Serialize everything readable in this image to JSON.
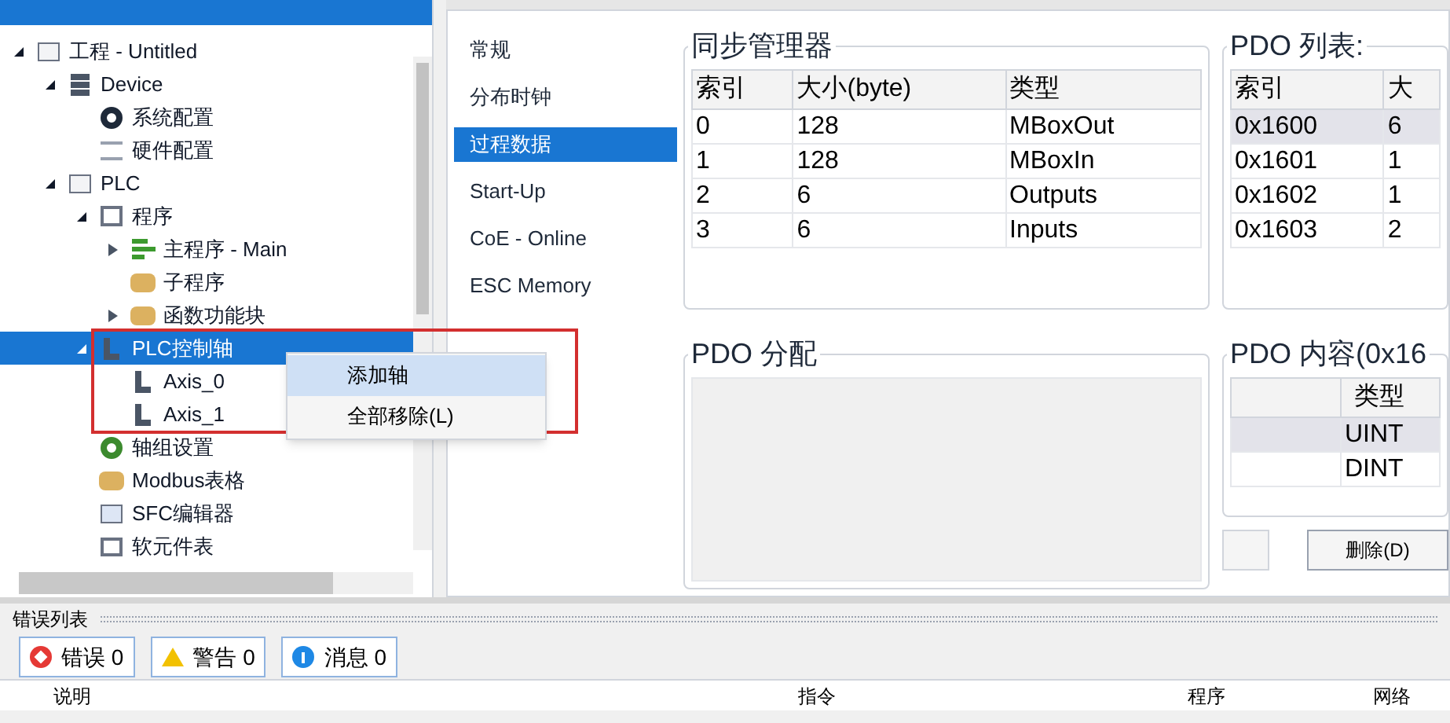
{
  "tree": [
    {
      "label": "工程 - Untitled",
      "kind": "project",
      "expanded": true,
      "selected": false,
      "children": [
        {
          "label": "Device",
          "kind": "device",
          "expanded": true,
          "selected": false,
          "children": [
            {
              "label": "系统配置",
              "kind": "gear",
              "selected": false
            },
            {
              "label": "硬件配置",
              "kind": "hardware",
              "selected": false
            }
          ]
        },
        {
          "label": "PLC",
          "kind": "plc",
          "expanded": true,
          "selected": false,
          "children": [
            {
              "label": "程序",
              "kind": "program",
              "expanded": true,
              "selected": false,
              "children": [
                {
                  "label": "主程序 - Main",
                  "kind": "main",
                  "expanded": false,
                  "selected": false
                },
                {
                  "label": "子程序",
                  "kind": "folder",
                  "selected": false
                },
                {
                  "label": "函数功能块",
                  "kind": "folder",
                  "expanded": false,
                  "selected": false
                }
              ]
            },
            {
              "label": "PLC控制轴",
              "kind": "axis",
              "expanded": true,
              "selected": true,
              "children": [
                {
                  "label": "Axis_0",
                  "kind": "axis",
                  "selected": false
                },
                {
                  "label": "Axis_1",
                  "kind": "axis",
                  "selected": false
                }
              ]
            },
            {
              "label": "轴组设置",
              "kind": "greengear",
              "selected": false
            },
            {
              "label": "Modbus表格",
              "kind": "folder",
              "selected": false
            },
            {
              "label": "SFC编辑器",
              "kind": "sfc",
              "selected": false
            },
            {
              "label": "软元件表",
              "kind": "table",
              "selected": false
            }
          ]
        }
      ]
    }
  ],
  "context_menu": [
    {
      "label": "添加轴",
      "selected": true
    },
    {
      "label": "全部移除(L)",
      "selected": false
    }
  ],
  "nav": [
    {
      "label": "常规",
      "selected": false
    },
    {
      "label": "分布时钟",
      "selected": false
    },
    {
      "label": "过程数据",
      "selected": true
    },
    {
      "label": "Start-Up",
      "selected": false
    },
    {
      "label": "CoE - Online",
      "selected": false
    },
    {
      "label": "ESC Memory",
      "selected": false
    }
  ],
  "sync_manager": {
    "title": "同步管理器",
    "columns": [
      "索引",
      "大小(byte)",
      "类型"
    ],
    "rows": [
      [
        "0",
        "128",
        "MBoxOut"
      ],
      [
        "1",
        "128",
        "MBoxIn"
      ],
      [
        "2",
        "6",
        "Outputs"
      ],
      [
        "3",
        "6",
        "Inputs"
      ]
    ]
  },
  "pdo_list": {
    "title": "PDO 列表:",
    "columns": [
      "索引",
      "大"
    ],
    "rows": [
      {
        "cells": [
          "0x1600",
          "6"
        ],
        "selected": true
      },
      {
        "cells": [
          "0x1601",
          "1"
        ],
        "selected": false
      },
      {
        "cells": [
          "0x1602",
          "1"
        ],
        "selected": false
      },
      {
        "cells": [
          "0x1603",
          "2"
        ],
        "selected": false
      }
    ]
  },
  "pdo_assign": {
    "title": "PDO 分配"
  },
  "pdo_content": {
    "title": "PDO 内容(0x16",
    "columns": [
      "类型"
    ],
    "rows": [
      {
        "cells": [
          "UINT"
        ],
        "selected": true
      },
      {
        "cells": [
          "DINT"
        ],
        "selected": false
      }
    ]
  },
  "buttons": [
    "删除(D)"
  ],
  "error_list": {
    "title": "错误列表",
    "filters": [
      {
        "kind": "error",
        "label": "错误 0"
      },
      {
        "kind": "warning",
        "label": "警告 0"
      },
      {
        "kind": "info",
        "label": "消息 0"
      }
    ],
    "columns": [
      "说明",
      "指令",
      "程序",
      "网络"
    ]
  }
}
